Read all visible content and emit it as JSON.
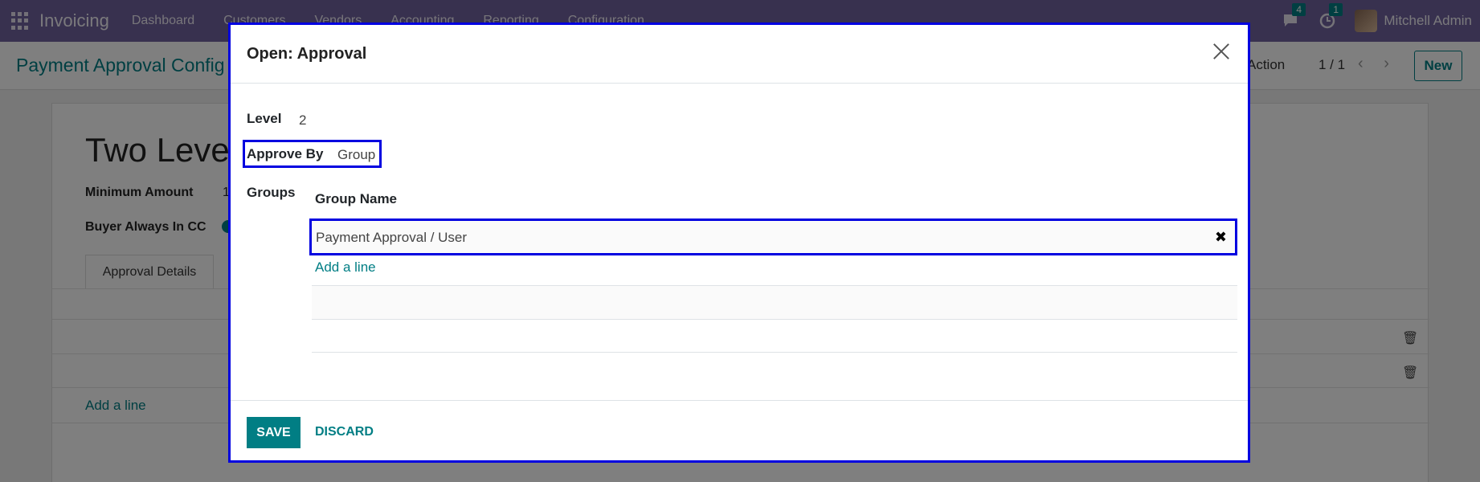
{
  "navbar": {
    "app_name": "Invoicing",
    "menu": [
      "Dashboard",
      "Customers",
      "Vendors",
      "Accounting",
      "Reporting",
      "Configuration"
    ],
    "messages_count": "4",
    "activities_count": "1",
    "user_name": "Mitchell Admin"
  },
  "control_panel": {
    "breadcrumb": "Payment Approval Config",
    "action_label": "Action",
    "pager": "1 / 1",
    "pager_arrows": "‹ ›",
    "new_label": "New"
  },
  "form": {
    "title": "Two Level",
    "minimum_amount_label": "Minimum Amount",
    "minimum_amount_value": "1",
    "buyer_cc_label": "Buyer Always In CC",
    "tab_label": "Approval Details",
    "add_line": "Add a line"
  },
  "modal": {
    "title": "Open: Approval",
    "level_label": "Level",
    "level_value": "2",
    "approve_by_label": "Approve By",
    "approve_by_value": "Group",
    "groups_label": "Groups",
    "group_name_header": "Group Name",
    "group_rows": [
      "Payment Approval / User"
    ],
    "add_line": "Add a line",
    "save_label": "SAVE",
    "discard_label": "DISCARD"
  },
  "colors": {
    "navbar": "#71639e",
    "accent": "#017e84",
    "highlight_border": "#0000e0"
  }
}
